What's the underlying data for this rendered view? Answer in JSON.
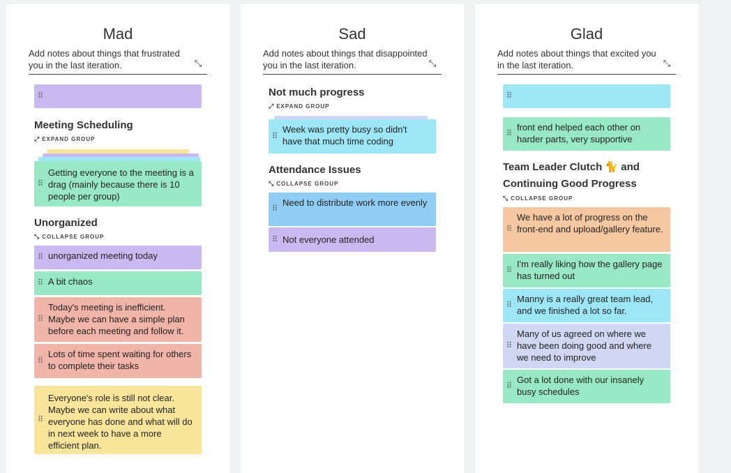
{
  "columns": [
    {
      "title": "Mad",
      "description": "Add notes about things that frustrated you in the last iteration.",
      "groups": [
        {
          "title": "Meeting Scheduling",
          "toggle": "EXPAND GROUP"
        },
        {
          "title": "Unorganized",
          "toggle": "COLLAPSE GROUP"
        }
      ],
      "cards": [
        "",
        "Getting everyone to the meeting is a drag (mainly because there is 10 people per group)",
        "unorganized meeting today",
        "A bit chaos",
        "Today's meeting is inefficient. Maybe we can have a simple plan before each meeting and follow it.",
        "Lots of time spent waiting for others to complete their tasks",
        "Everyone's role is still not clear. Maybe we can write about what everyone has done and what will do in next week to have a more efficient plan."
      ]
    },
    {
      "title": "Sad",
      "description": "Add notes about things that disappointed you in the last iteration.",
      "groups": [
        {
          "title": "Not much progress",
          "toggle": "EXPAND GROUP"
        },
        {
          "title": "Attendance Issues",
          "toggle": "COLLAPSE GROUP"
        }
      ],
      "cards": [
        "Week was pretty busy so didn't have that much time coding",
        "Need to distribute work more evenly",
        "Not everyone attended"
      ]
    },
    {
      "title": "Glad",
      "description": "Add notes about things that excited you in the last iteration.",
      "groups": [
        {
          "title": "Team Leader Clutch 🐈 and Continuing Good Progress",
          "toggle": "COLLAPSE GROUP"
        }
      ],
      "cards": [
        "",
        "front end helped each other on harder parts, very supportive",
        "We have a lot of progress on the front-end and upload/gallery feature.",
        "I'm really liking how the gallery page has turned out",
        "Manny is a really great team lead, and we finished a lot so far.",
        "Many of us agreed on where we have been doing good and where we need to improve",
        "Got a lot done with our insanely busy schedules"
      ]
    }
  ],
  "colors": {
    "purple": "#cab8f1",
    "green": "#98e7c5",
    "salmon": "#f0b4a8",
    "yellow": "#f8e59a",
    "cyan": "#9ce6f6",
    "blue": "#8fcdf5",
    "orange": "#f6c8a2",
    "lavender": "#cfd7f2"
  },
  "icons": {
    "collapse": "collapse-arrows-icon",
    "expand": "expand-arrows-icon",
    "drag": "drag-handle-icon"
  }
}
